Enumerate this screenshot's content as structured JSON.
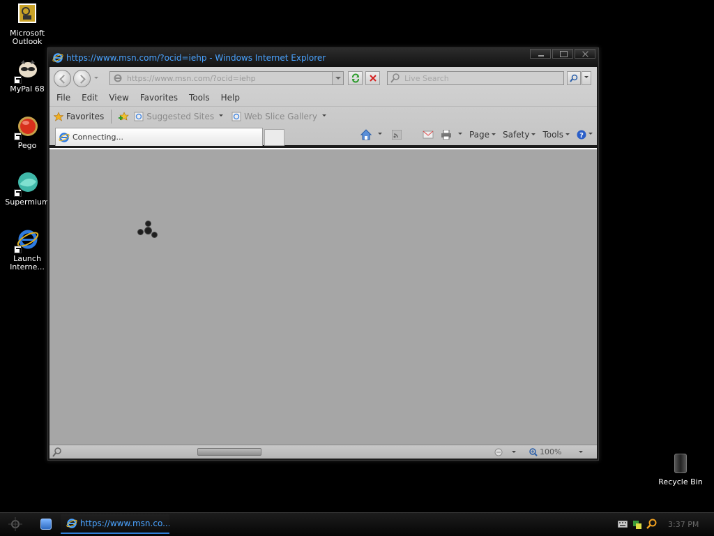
{
  "desktop": {
    "icons": [
      {
        "label": "Microsoft Outlook"
      },
      {
        "label": "MyPal 68"
      },
      {
        "label": "Pego"
      },
      {
        "label": "Supermium"
      },
      {
        "label": "Launch Interne..."
      }
    ],
    "recycle_bin": {
      "label": "Recycle Bin"
    }
  },
  "window": {
    "title": "https://www.msn.com/?ocid=iehp - Windows Internet Explorer",
    "address": "https://www.msn.com/?ocid=iehp",
    "search_placeholder": "Live Search",
    "menu": [
      "File",
      "Edit",
      "View",
      "Favorites",
      "Tools",
      "Help"
    ],
    "favorites": {
      "label": "Favorites",
      "suggested_sites": "Suggested Sites",
      "web_slice_gallery": "Web Slice Gallery"
    },
    "tab": {
      "label": "Connecting..."
    },
    "command_bar": {
      "page": "Page",
      "safety": "Safety",
      "tools": "Tools"
    },
    "status": {
      "zoom": "100%"
    }
  },
  "taskbar": {
    "task_label": "https://www.msn.co...",
    "clock": "3:37 PM"
  },
  "colors": {
    "title_text": "#4aa3ff",
    "content_bg": "#a6a6a6",
    "desktop_bg": "#000000"
  }
}
